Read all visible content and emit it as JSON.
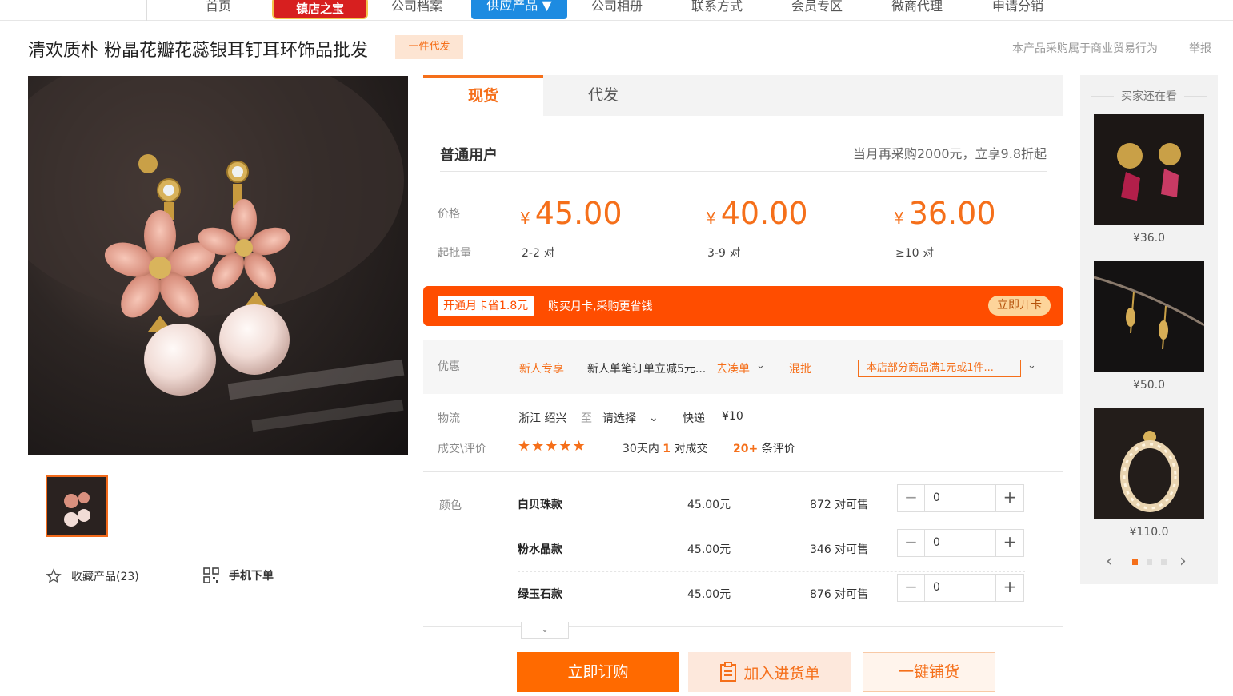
{
  "nav": {
    "items": [
      "首页",
      "公司档案",
      "供应产品 ▼",
      "公司相册",
      "联系方式",
      "会员专区",
      "微商代理",
      "申请分销"
    ],
    "badge": "镇店之宝"
  },
  "product": {
    "title": "清欢质朴 粉晶花瓣花蕊银耳钉耳环饰品批发",
    "badge": "一件代发",
    "trade_note": "本产品采购属于商业贸易行为",
    "report": "举报"
  },
  "gallery": {
    "favorite": "收藏产品(23)",
    "mobile_order": "手机下单"
  },
  "tabs": {
    "active": "现货",
    "inactive": "代发"
  },
  "pricing": {
    "user_type": "普通用户",
    "discount_note": "当月再采购2000元，立享9.8折起",
    "price_label": "价格",
    "moq_label": "起批量",
    "currency": "¥",
    "tiers": [
      {
        "price": "45.00",
        "qty": "2-2  对"
      },
      {
        "price": "40.00",
        "qty": "3-9  对"
      },
      {
        "price": "36.00",
        "qty": "≥10  对"
      }
    ]
  },
  "banner": {
    "tag": "开通月卡省1.8元",
    "text": "购买月卡,采购更省钱",
    "button": "立即开卡"
  },
  "promo": {
    "label": "优惠",
    "newbie": "新人专享",
    "newbie_text": "新人单笔订单立减5元...",
    "coudan": "去凑单",
    "mixed": "混批",
    "rule": "本店部分商品满1元或1件..."
  },
  "logistics": {
    "label": "物流",
    "from": "浙江  绍兴",
    "to_word": "至",
    "select": "请选择",
    "express": "快递",
    "fee": "¥10"
  },
  "deal": {
    "label": "成交\\评价",
    "stars": "★★★★★",
    "days_prefix": "30天内",
    "days_count": "1",
    "days_suffix": "对成交",
    "review_count": "20+",
    "review_suffix": "条评价"
  },
  "variants": {
    "label": "颜色",
    "items": [
      {
        "name": "白贝珠款",
        "price": "45.00元",
        "stock": "872 对可售",
        "qty": "0"
      },
      {
        "name": "粉水晶款",
        "price": "45.00元",
        "stock": "346 对可售",
        "qty": "0"
      },
      {
        "name": "绿玉石款",
        "price": "45.00元",
        "stock": "876 对可售",
        "qty": "0"
      }
    ]
  },
  "actions": {
    "order": "立即订购",
    "cart": "加入进货单",
    "stock": "一键铺货"
  },
  "sidebar": {
    "title": "买家还在看",
    "items": [
      {
        "price": "¥36.0"
      },
      {
        "price": "¥50.0"
      },
      {
        "price": "¥110.0"
      }
    ]
  },
  "colors": {
    "accent": "#f56f1a",
    "banner": "#ff4d00",
    "nav_active": "#1d8be1"
  }
}
